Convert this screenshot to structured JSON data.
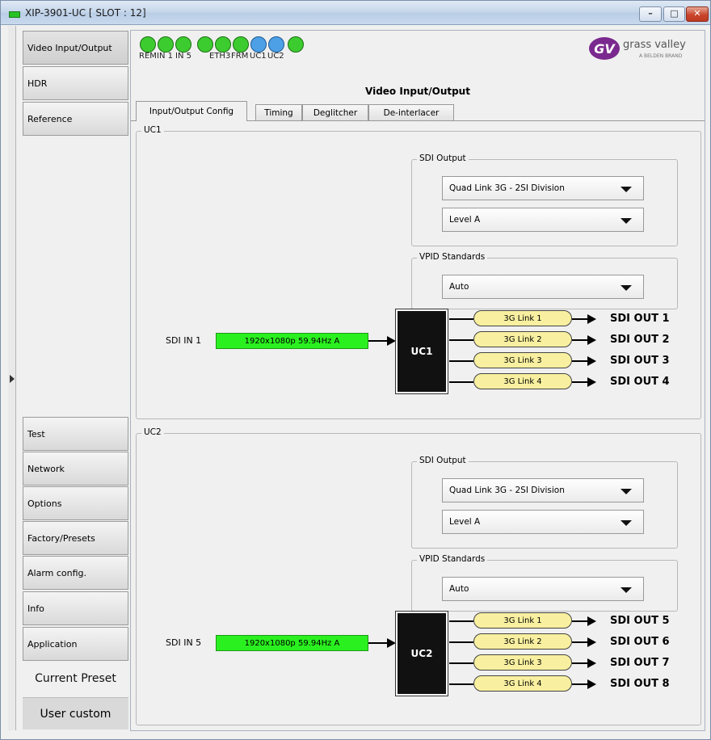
{
  "window": {
    "title": "XIP-3901-UC [ SLOT : 12]"
  },
  "sidebar": {
    "items": [
      {
        "label": "Video Input/Output"
      },
      {
        "label": "HDR"
      },
      {
        "label": "Reference"
      },
      {
        "label": "Test"
      },
      {
        "label": "Network"
      },
      {
        "label": "Options"
      },
      {
        "label": "Factory/Presets"
      },
      {
        "label": "Alarm config."
      },
      {
        "label": "Info"
      },
      {
        "label": "Application"
      }
    ],
    "current_preset_label": "Current Preset",
    "current_preset_value": "User custom"
  },
  "status_icons": [
    {
      "name": "CTRL",
      "label": "REM"
    },
    {
      "name": "IN1",
      "label": "IN 1"
    },
    {
      "name": "IN5",
      "label": "IN 5"
    },
    {
      "name": "REF",
      "label": ""
    },
    {
      "name": "ETH3",
      "label": "ETH3"
    },
    {
      "name": "FRM",
      "label": "FRM"
    },
    {
      "name": "UC1",
      "label": "UC1"
    },
    {
      "name": "UC2",
      "label": "UC2"
    },
    {
      "name": "PLUS",
      "label": ""
    }
  ],
  "logo": {
    "text": "grass valley",
    "sub": "A BELDEN BRAND",
    "mark": "GV"
  },
  "page_title": "Video Input/Output",
  "tabs": [
    {
      "label": "Input/Output Config"
    },
    {
      "label": "Timing"
    },
    {
      "label": "Deglitcher"
    },
    {
      "label": "De-interlacer"
    }
  ],
  "uc1": {
    "group_label": "UC1",
    "sdi_output_label": "SDI Output",
    "sdi_output_value": "Quad Link 3G - 2SI Division",
    "level_value": "Level A",
    "vpid_label": "VPID Standards",
    "vpid_value": "Auto",
    "input_label": "SDI IN 1",
    "input_signal": "1920x1080p 59.94Hz A",
    "box_label": "UC1",
    "links": [
      "3G Link 1",
      "3G Link 2",
      "3G Link 3",
      "3G Link 4"
    ],
    "outputs": [
      "SDI OUT 1",
      "SDI OUT 2",
      "SDI OUT 3",
      "SDI OUT 4"
    ]
  },
  "uc2": {
    "group_label": "UC2",
    "sdi_output_label": "SDI Output",
    "sdi_output_value": "Quad Link 3G - 2SI Division",
    "level_value": "Level A",
    "vpid_label": "VPID Standards",
    "vpid_value": "Auto",
    "input_label": "SDI IN 5",
    "input_signal": "1920x1080p 59.94Hz A",
    "box_label": "UC2",
    "links": [
      "3G Link 1",
      "3G Link 2",
      "3G Link 3",
      "3G Link 4"
    ],
    "outputs": [
      "SDI OUT 5",
      "SDI OUT 6",
      "SDI OUT 7",
      "SDI OUT 8"
    ]
  }
}
